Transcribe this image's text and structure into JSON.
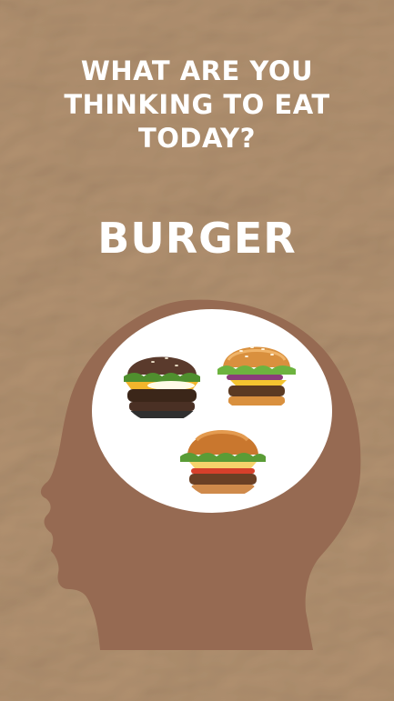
{
  "headline": {
    "lines": [
      "WHAT ARE YOU",
      "THINKING TO EAT",
      "TODAY?"
    ]
  },
  "answer": "BURGER",
  "colors": {
    "background": "#c8ad91",
    "head": "#966a52",
    "thought_bubble": "#ffffff",
    "text": "#ffffff"
  },
  "images": [
    {
      "name": "burger-photo-dark-bun",
      "description": "burger-icon"
    },
    {
      "name": "burger-photo-sesame-bun",
      "description": "burger-icon"
    },
    {
      "name": "burger-photo-classic",
      "description": "burger-icon"
    }
  ]
}
